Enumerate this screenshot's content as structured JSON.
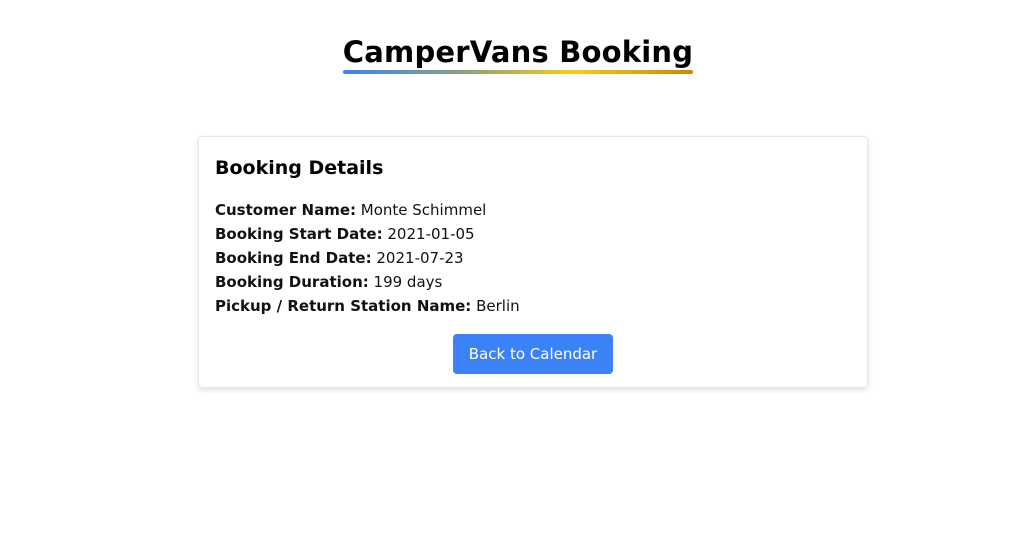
{
  "header": {
    "title": "CamperVans Booking"
  },
  "booking": {
    "heading": "Booking Details",
    "fields": [
      {
        "label": "Customer Name:",
        "value": "Monte Schimmel"
      },
      {
        "label": "Booking Start Date:",
        "value": "2021-01-05"
      },
      {
        "label": "Booking End Date:",
        "value": "2021-07-23"
      },
      {
        "label": "Booking Duration:",
        "value": "199 days"
      },
      {
        "label": "Pickup / Return Station Name:",
        "value": "Berlin"
      }
    ],
    "back_button_label": "Back to Calendar"
  },
  "colors": {
    "button": "#3b82f6",
    "underline_start": "#3b82f6",
    "underline_mid": "#facc15",
    "underline_end": "#ca8a04"
  }
}
